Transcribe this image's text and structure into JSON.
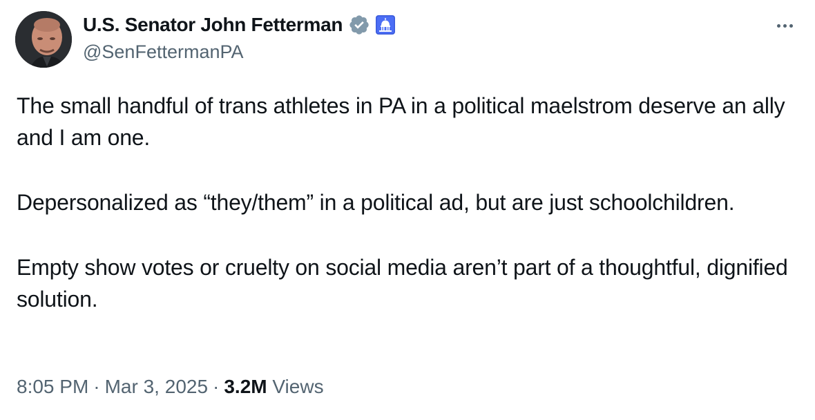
{
  "author": {
    "display_name": "U.S. Senator John Fetterman",
    "handle": "@SenFettermanPA",
    "avatar_icon": "profile-photo",
    "verified_icon": "verified-badge-icon",
    "affiliation_icon": "capitol-dome-icon"
  },
  "tweet": {
    "paragraphs": [
      "The small handful of trans athletes in PA in a political maelstrom deserve an ally and I am one.",
      "Depersonalized as “they/them” in a political ad, but are just schoolchildren.",
      "Empty show votes or cruelty on social media aren’t part of a thoughtful, dignified solution."
    ]
  },
  "meta": {
    "time": "8:05 PM",
    "separator": "·",
    "date": "Mar 3, 2025",
    "views_count": "3.2M",
    "views_label": "Views"
  },
  "colors": {
    "text_primary": "#0f1419",
    "text_secondary": "#536471",
    "verified_gray": "#829aab",
    "gov_badge": "#3b5bdb"
  }
}
